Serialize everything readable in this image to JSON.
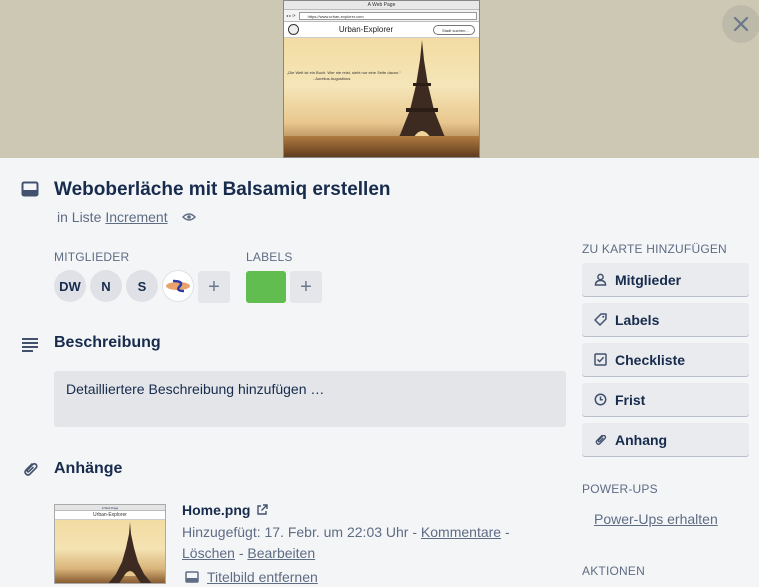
{
  "cover": {
    "window_title": "A Web Page",
    "url": "https://www.urban-explorer.com",
    "brand": "Urban-Explorer",
    "search_placeholder": "Stadt suchen...",
    "quote_line1": "„Die Welt ist ein Buch. Wer nie reist, sieht nur eine Seite davon.“",
    "quote_line2": "- Aurelius Augustinus"
  },
  "card": {
    "title": "Weboberläche mit Balsamiq erstellen",
    "in_list_prefix": "in Liste",
    "list_name": "Increment"
  },
  "members": {
    "label": "MITGLIEDER",
    "avatars": [
      "DW",
      "N",
      "S"
    ]
  },
  "labels": {
    "label": "LABELS",
    "color": "#61bd4f"
  },
  "description": {
    "title": "Beschreibung",
    "placeholder": "Detailliertere Beschreibung hinzufügen …"
  },
  "attachments": {
    "title": "Anhänge",
    "items": [
      {
        "name": "Home.png",
        "added_prefix": "Hinzugefügt: 17. Febr. um 22:03 Uhr",
        "comments": "Kommentare",
        "delete": "Löschen",
        "edit": "Bearbeiten",
        "remove_cover": "Titelbild entfernen",
        "thumb_title": "A Web Page",
        "thumb_brand": "Urban-Explorer"
      }
    ]
  },
  "sidebar": {
    "add_to_card_label": "ZU KARTE HINZUFÜGEN",
    "buttons": [
      {
        "label": "Mitglieder",
        "icon": "person-icon"
      },
      {
        "label": "Labels",
        "icon": "tag-icon"
      },
      {
        "label": "Checkliste",
        "icon": "checkbox-icon"
      },
      {
        "label": "Frist",
        "icon": "clock-icon"
      },
      {
        "label": "Anhang",
        "icon": "paperclip-icon"
      }
    ],
    "powerups_label": "POWER-UPS",
    "powerups_link": "Power-Ups erhalten",
    "actions_label": "AKTIONEN"
  }
}
